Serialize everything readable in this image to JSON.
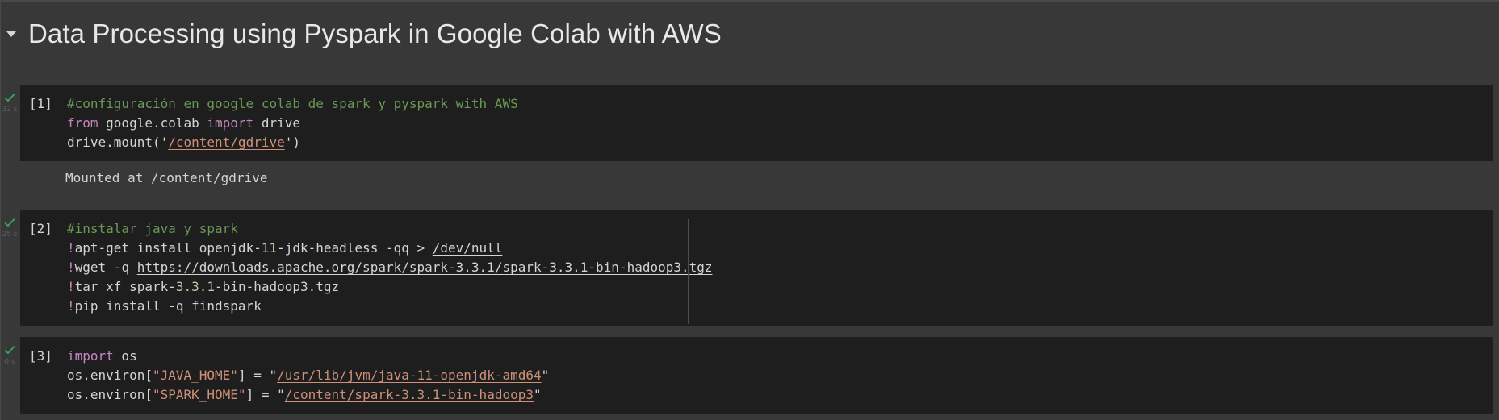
{
  "section": {
    "title": "Data Processing using Pyspark in Google Colab with AWS"
  },
  "cells": [
    {
      "count": "[1]",
      "exec_time": "32 s",
      "lines": [
        [
          {
            "t": "#configuración en google colab de spark y pyspark with AWS",
            "c": "comment"
          }
        ],
        [
          {
            "t": "from",
            "c": "kw"
          },
          {
            "t": " google.colab "
          },
          {
            "t": "import",
            "c": "kw"
          },
          {
            "t": " drive"
          }
        ],
        [
          {
            "t": "drive.mount("
          },
          {
            "t": "'"
          },
          {
            "t": "/content/gdrive",
            "c": "str u"
          },
          {
            "t": "'"
          },
          {
            "t": ")"
          }
        ]
      ],
      "output": "Mounted at /content/gdrive"
    },
    {
      "count": "[2]",
      "exec_time": "25 s",
      "lines": [
        [
          {
            "t": "#instalar java y spark",
            "c": "comment"
          }
        ],
        [
          {
            "t": "!",
            "c": "kw"
          },
          {
            "t": "apt-get install openjdk-"
          },
          {
            "t": "11",
            "c": "num"
          },
          {
            "t": "-jdk-headless -qq > "
          },
          {
            "t": "/dev/null",
            "c": "u"
          }
        ],
        [
          {
            "t": "!",
            "c": "kw"
          },
          {
            "t": "wget -q "
          },
          {
            "t": "https://downloads.apache.org/spark/spark-3.3.1/spark-3.3.1-bin-hadoop3.tgz",
            "c": "u"
          }
        ],
        [
          {
            "t": "!",
            "c": "kw"
          },
          {
            "t": "tar xf spark-"
          },
          {
            "t": "3.3.1",
            "c": "num"
          },
          {
            "t": "-bin-hadoop3.tgz"
          }
        ],
        [
          {
            "t": "!",
            "c": "kw"
          },
          {
            "t": "pip install -q findspark"
          }
        ]
      ]
    },
    {
      "count": "[3]",
      "exec_time": "0 s",
      "lines": [
        [
          {
            "t": "import",
            "c": "kw"
          },
          {
            "t": " os"
          }
        ],
        [
          {
            "t": "os.environ["
          },
          {
            "t": "\"JAVA_HOME\"",
            "c": "str"
          },
          {
            "t": "] = "
          },
          {
            "t": "\""
          },
          {
            "t": "/usr/lib/jvm/java-11-openjdk-amd64",
            "c": "str u"
          },
          {
            "t": "\""
          }
        ],
        [
          {
            "t": "os.environ["
          },
          {
            "t": "\"SPARK_HOME\"",
            "c": "str"
          },
          {
            "t": "] = "
          },
          {
            "t": "\""
          },
          {
            "t": "/content/spark-3.3.1-bin-hadoop3",
            "c": "str u"
          },
          {
            "t": "\""
          }
        ]
      ]
    }
  ]
}
